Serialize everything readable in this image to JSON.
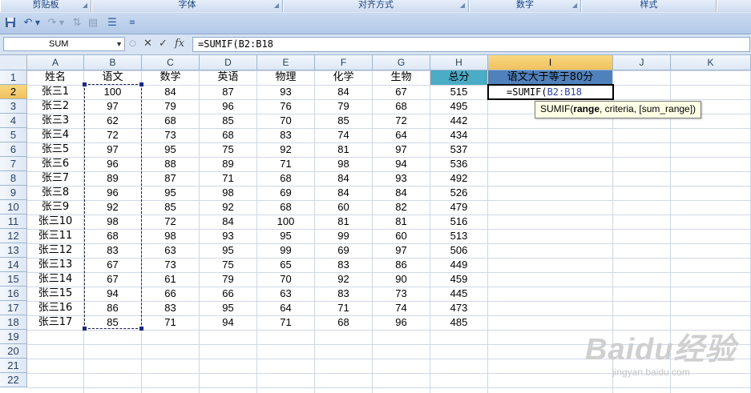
{
  "ribbon": {
    "groups": [
      {
        "label": "剪贴板"
      },
      {
        "label": "字体"
      },
      {
        "label": "对齐方式"
      },
      {
        "label": "数字"
      },
      {
        "label": "样式"
      }
    ]
  },
  "qat": {
    "icons": [
      "save-icon",
      "undo-icon",
      "redo-icon",
      "sort-icon",
      "filter-icon",
      "list-icon",
      "customize-icon"
    ]
  },
  "formula_bar": {
    "name_box": "SUM",
    "cancel_glyph": "✕",
    "enter_glyph": "✓",
    "fx_glyph": "fx",
    "formula": "=SUMIF(B2:B18"
  },
  "sheet": {
    "columns": [
      "A",
      "B",
      "C",
      "D",
      "E",
      "F",
      "G",
      "H",
      "I",
      "J",
      "K"
    ],
    "active_column": "I",
    "active_row": "2",
    "row_numbers": [
      "1",
      "2",
      "3",
      "4",
      "5",
      "6",
      "7",
      "8",
      "9",
      "10",
      "11",
      "12",
      "13",
      "14",
      "15",
      "16",
      "17",
      "18",
      "19",
      "20",
      "21",
      "22"
    ],
    "header": [
      "姓名",
      "语文",
      "数学",
      "英语",
      "物理",
      "化学",
      "生物",
      "总分",
      "语文大于等于80分"
    ],
    "rows": [
      [
        "张三1",
        "100",
        "84",
        "87",
        "93",
        "84",
        "67",
        "515"
      ],
      [
        "张三2",
        "97",
        "79",
        "96",
        "76",
        "79",
        "68",
        "495"
      ],
      [
        "张三3",
        "62",
        "68",
        "85",
        "70",
        "85",
        "72",
        "442"
      ],
      [
        "张三4",
        "72",
        "73",
        "68",
        "83",
        "74",
        "64",
        "434"
      ],
      [
        "张三5",
        "97",
        "95",
        "75",
        "92",
        "81",
        "97",
        "537"
      ],
      [
        "张三6",
        "96",
        "88",
        "89",
        "71",
        "98",
        "94",
        "536"
      ],
      [
        "张三7",
        "89",
        "87",
        "71",
        "68",
        "84",
        "93",
        "492"
      ],
      [
        "张三8",
        "96",
        "95",
        "98",
        "69",
        "84",
        "84",
        "526"
      ],
      [
        "张三9",
        "92",
        "85",
        "92",
        "68",
        "60",
        "82",
        "479"
      ],
      [
        "张三10",
        "98",
        "72",
        "84",
        "100",
        "81",
        "81",
        "516"
      ],
      [
        "张三11",
        "68",
        "98",
        "93",
        "95",
        "99",
        "60",
        "513"
      ],
      [
        "张三12",
        "83",
        "63",
        "95",
        "99",
        "69",
        "97",
        "506"
      ],
      [
        "张三13",
        "67",
        "73",
        "75",
        "65",
        "83",
        "86",
        "449"
      ],
      [
        "张三14",
        "67",
        "61",
        "79",
        "70",
        "92",
        "90",
        "459"
      ],
      [
        "张三15",
        "94",
        "66",
        "66",
        "63",
        "83",
        "73",
        "445"
      ],
      [
        "张三16",
        "86",
        "83",
        "95",
        "64",
        "71",
        "74",
        "473"
      ],
      [
        "张三17",
        "85",
        "71",
        "94",
        "71",
        "68",
        "96",
        "485"
      ]
    ],
    "editing_cell": {
      "prefix": "=SUMIF(",
      "ref": "B2:B18"
    }
  },
  "tooltip": {
    "fn": "SUMIF(",
    "arg_bold": "range",
    "rest": ", criteria, [sum_range])"
  },
  "watermark": {
    "logo": "Baidu经验",
    "url": "jingyan.baidu.com"
  }
}
